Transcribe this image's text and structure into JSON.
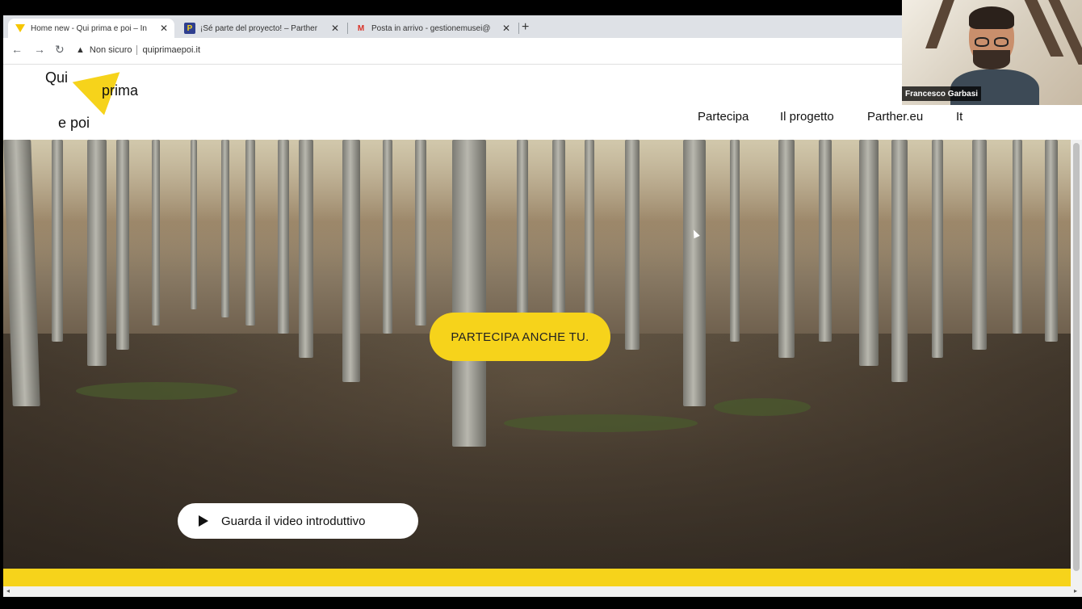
{
  "browser": {
    "tabs": [
      {
        "title": "Home new - Qui prima e poi – In",
        "active": true,
        "favicon": "yellow-triangle"
      },
      {
        "title": "¡Sé parte del proyecto! – Parther",
        "active": false,
        "favicon": "parthenos-logo"
      },
      {
        "title": "Posta in arrivo - gestionemusei@",
        "active": false,
        "favicon": "gmail-logo"
      }
    ],
    "new_tab": "+",
    "security_label": "Non sicuro",
    "url": "quiprimaepoi.it"
  },
  "site": {
    "logo": {
      "w1": "Qui",
      "w2": "prima",
      "w3": "e poi"
    },
    "nav": [
      "Partecipa",
      "Il progetto",
      "Parther.eu",
      "It"
    ],
    "cta": "PARTECIPA ANCHE TU.",
    "video_button": "Guarda il video introduttivo",
    "accent_color": "#f6d31b"
  },
  "webcam": {
    "name": "Francesco Garbasi"
  }
}
